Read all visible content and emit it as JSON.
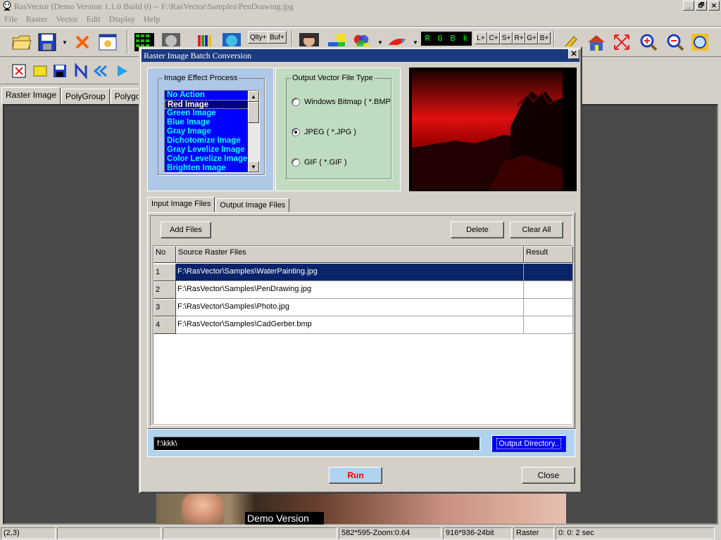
{
  "window": {
    "title": "RasVector (Demo Version 1.1.0 Build 0) -- F:\\RasVector\\Samples\\PenDrawing.jpg",
    "min": "_",
    "restore": "🗗",
    "close": "✕"
  },
  "menu": [
    "File",
    "Raster",
    "Vector",
    "Edit",
    "Display",
    "Help"
  ],
  "toolbar": {
    "qlty": "Qlty+",
    "buf": "Buf+",
    "rgbk": [
      "R",
      "G",
      "B",
      "k"
    ],
    "channels": [
      "L+",
      "C+",
      "S+",
      "R+",
      "G+",
      "B+"
    ]
  },
  "main_tabs": [
    "Raster Image",
    "PolyGroup",
    "Polygon"
  ],
  "canvas": {
    "demo_label": "Demo Version"
  },
  "statusbar": [
    "(2,3)",
    "",
    "",
    "582*595-Zoom:0.64",
    "916*936-24bit",
    "Raster",
    "0: 0: 2 sec"
  ],
  "dialog": {
    "title": "Raster Image Batch Conversion",
    "close": "✕",
    "effect_group": "Image Effect Process",
    "effects": [
      "No Action",
      "Red Image",
      "Green Image",
      "Blue Image",
      "Gray Image",
      "Dichotomize Image",
      "Gray Levelize Image",
      "Color Levelize Image",
      "Brighten Image"
    ],
    "selected_effect": "Red Image",
    "vector_group": "Output Vector File Type",
    "file_types": [
      {
        "label": "Windows Bitmap  ( *.BMP",
        "checked": false
      },
      {
        "label": "JPEG  ( *.JPG )",
        "checked": true
      },
      {
        "label": "GIF ( *.GIF )",
        "checked": false
      }
    ],
    "file_tabs": [
      "Input Image Files",
      "Output Image Files"
    ],
    "add_files": "Add Files",
    "delete": "Delete",
    "clear_all": "Clear All",
    "columns": [
      "No",
      "Source Raster Files",
      "Result"
    ],
    "rows": [
      {
        "no": "1",
        "src": "F:\\RasVector\\Samples\\WaterPainting.jpg",
        "res": "",
        "selected": true
      },
      {
        "no": "2",
        "src": "F:\\RasVector\\Samples\\PenDrawing.jpg",
        "res": "",
        "selected": false
      },
      {
        "no": "3",
        "src": "F:\\RasVector\\Samples\\Photo.jpg",
        "res": "",
        "selected": false
      },
      {
        "no": "4",
        "src": "F:\\RasVector\\Samples\\CadGerber.bmp",
        "res": "",
        "selected": false
      }
    ],
    "output_dir": "f:\\kkk\\",
    "output_dir_button": "Output Directory..",
    "run": "Run",
    "close_button": "Close"
  }
}
